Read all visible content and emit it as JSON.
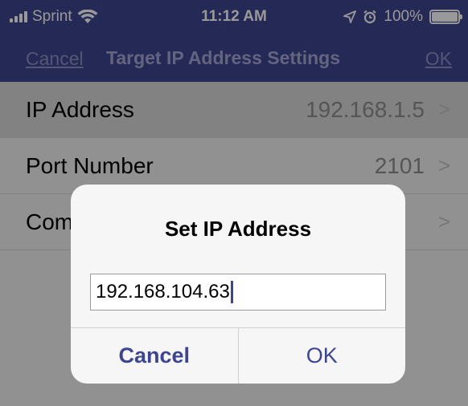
{
  "status_bar": {
    "carrier": "Sprint",
    "time": "11:12 AM",
    "battery": "100%",
    "icons": [
      "signal-icon",
      "wifi-icon",
      "location-icon",
      "alarm-icon",
      "battery-icon"
    ]
  },
  "nav": {
    "cancel_label": "Cancel",
    "title": "Target IP Address Settings",
    "ok_label": "OK"
  },
  "rows": [
    {
      "label": "IP Address",
      "value": "192.168.1.5",
      "chevron": ">"
    },
    {
      "label": "Port Number",
      "value": "2101",
      "chevron": ">"
    },
    {
      "label": "Com",
      "value": "",
      "chevron": ">"
    }
  ],
  "alert": {
    "title": "Set IP Address",
    "input_value": "192.168.104.63",
    "cancel_label": "Cancel",
    "ok_label": "OK"
  },
  "colors": {
    "nav_background": "#3e4590",
    "accent": "#3e4590"
  }
}
